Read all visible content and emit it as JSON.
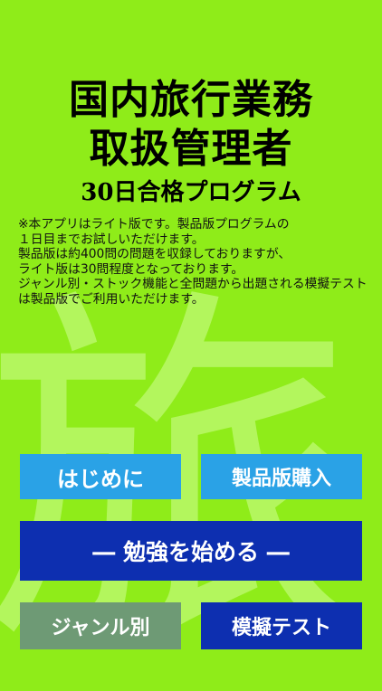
{
  "title": {
    "line1": "国内旅行業務",
    "line2": "取扱管理者",
    "subtitle": "30日合格プログラム"
  },
  "watermark": "旅",
  "notice": "※本アプリはライト版です。製品版プログラムの\n１日目までお試しいただけます。\n製品版は約400問の問題を収録しておりますが、\nライト版は30問程度となっております。\nジャンル別・ストック機能と全問題から出題される模擬テストは製品版でご利用いただけます。",
  "buttons": {
    "intro": "はじめに",
    "buy": "製品版購入",
    "start": "― 勉強を始める ―",
    "genre": "ジャンル別",
    "mock_test": "模擬テスト"
  },
  "colors": {
    "background": "#8fec19",
    "light_blue": "#2aa2e6",
    "dark_blue": "#0d2fb0",
    "gray_green": "#6e9a75"
  }
}
